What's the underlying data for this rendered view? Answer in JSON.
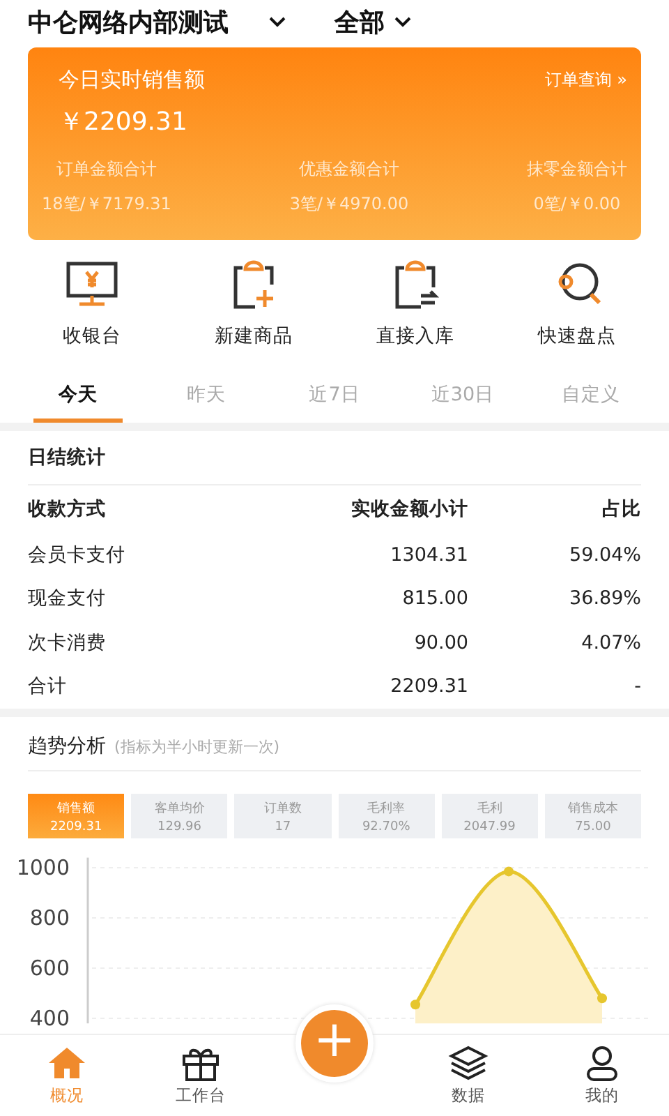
{
  "header": {
    "store": "中仑网络内部测试",
    "scope": "全部"
  },
  "sales_card": {
    "title": "今日实时销售额",
    "link": "订单查询 »",
    "amount": "￥2209.31",
    "stats": [
      {
        "label": "订单金额合计",
        "value": "18笔/￥7179.31"
      },
      {
        "label": "优惠金额合计",
        "value": "3笔/￥4970.00"
      },
      {
        "label": "抹零金额合计",
        "value": "0笔/￥0.00"
      }
    ]
  },
  "shortcuts": [
    {
      "kind": "cashier",
      "label": "收银台"
    },
    {
      "kind": "new",
      "label": "新建商品"
    },
    {
      "kind": "stock",
      "label": "直接入库"
    },
    {
      "kind": "count",
      "label": "快速盘点"
    }
  ],
  "periods": [
    {
      "label": "今天",
      "selected": true
    },
    {
      "label": "昨天",
      "selected": false
    },
    {
      "label": "近7日",
      "selected": false
    },
    {
      "label": "近30日",
      "selected": false
    },
    {
      "label": "自定义",
      "selected": false
    }
  ],
  "daily": {
    "title": "日结统计",
    "columns": [
      "收款方式",
      "实收金额小计",
      "占比"
    ],
    "rows": [
      [
        "会员卡支付",
        "1304.31",
        "59.04%"
      ],
      [
        "现金支付",
        "815.00",
        "36.89%"
      ],
      [
        "次卡消费",
        "90.00",
        "4.07%"
      ],
      [
        "合计",
        "2209.31",
        "-"
      ]
    ]
  },
  "trend": {
    "title": "趋势分析",
    "note": "(指标为半小时更新一次)",
    "metrics": [
      {
        "label": "销售额",
        "value": "2209.31",
        "selected": true
      },
      {
        "label": "客单均价",
        "value": "129.96",
        "selected": false
      },
      {
        "label": "订单数",
        "value": "17",
        "selected": false
      },
      {
        "label": "毛利率",
        "value": "92.70%",
        "selected": false
      },
      {
        "label": "毛利",
        "value": "2047.99",
        "selected": false
      },
      {
        "label": "销售成本",
        "value": "75.00",
        "selected": false
      }
    ],
    "chart_data": {
      "type": "area",
      "series": [
        {
          "color": "#e6c62e",
          "values": [
            null,
            null,
            null,
            455,
            985,
            480
          ]
        }
      ],
      "ylim": [
        380,
        1040
      ],
      "yticks": [
        400,
        600,
        800,
        1000
      ],
      "grid": true
    }
  },
  "fab": {
    "label": "+"
  },
  "nav": [
    {
      "kind": "home",
      "label": "概况",
      "selected": true
    },
    {
      "kind": "gift",
      "label": "工作台",
      "selected": false
    },
    {
      "kind": "layers",
      "label": "数据",
      "selected": false
    },
    {
      "kind": "user",
      "label": "我的",
      "selected": false
    }
  ]
}
